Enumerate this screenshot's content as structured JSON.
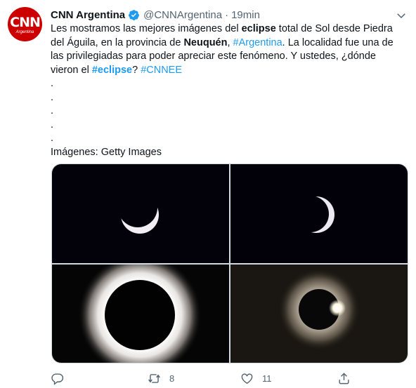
{
  "account": {
    "avatar_text": "CNN",
    "avatar_subtext": "Argentina",
    "name": "CNN Argentina",
    "handle": "@CNNArgentina",
    "separator": "·",
    "time": "19min"
  },
  "tweet": {
    "line1_a": "Les mostramos las mejores imágenes del ",
    "line1_b": "eclipse",
    "line1_c": " total de Sol desde Piedra",
    "line2_a": "del Águila, en la provincia de ",
    "line2_b": "Neuquén",
    "line2_c": ", ",
    "line2_link": "#Argentina",
    "line2_d": ". La localidad fue una de",
    "line3": "las privilegiadas para poder apreciar este fenómeno. Y ustedes, ¿dónde",
    "line4_a": "vieron el ",
    "line4_link": "#eclipse",
    "line4_b": "? ",
    "line4_link2": "#CNNEE",
    "dot1": ".",
    "dot2": ".",
    "dot3": ".",
    "dot4": ".",
    "dot5": ".",
    "credit": "Imágenes: Getty Images"
  },
  "actions": {
    "reply_count": "",
    "retweet_count": "8",
    "like_count": "11"
  },
  "colors": {
    "link": "#1d9bf0",
    "verified": "#1d9bf0",
    "brand": "#cc0000",
    "muted": "#536471"
  },
  "icons": [
    "verified-badge-icon",
    "more-icon",
    "reply-icon",
    "retweet-icon",
    "like-icon",
    "share-icon"
  ]
}
